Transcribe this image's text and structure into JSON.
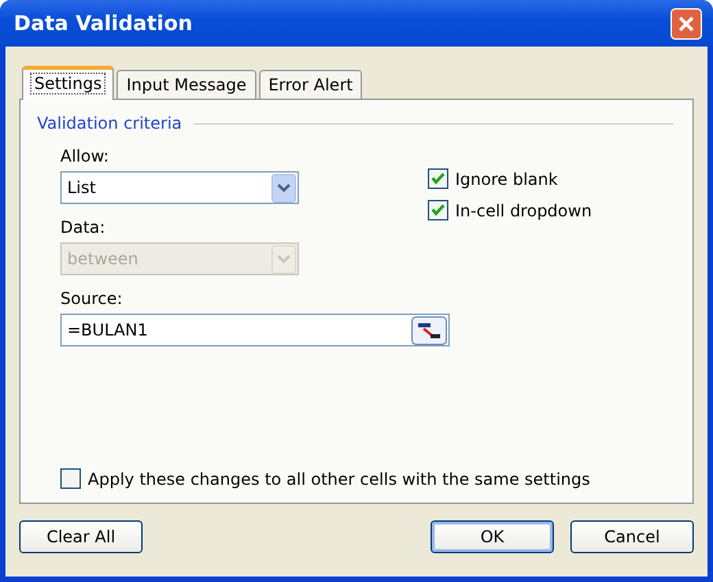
{
  "window": {
    "title": "Data Validation"
  },
  "tabs": [
    {
      "label": "Settings",
      "selected": true
    },
    {
      "label": "Input Message",
      "selected": false
    },
    {
      "label": "Error Alert",
      "selected": false
    }
  ],
  "group": {
    "title": "Validation criteria"
  },
  "allow": {
    "label": "Allow:",
    "value": "List",
    "disabled": false
  },
  "data": {
    "label": "Data:",
    "value": "between",
    "disabled": true
  },
  "options": [
    {
      "label": "Ignore blank",
      "checked": true
    },
    {
      "label": "In-cell dropdown",
      "checked": true
    }
  ],
  "source": {
    "label": "Source:",
    "value": "=BULAN1"
  },
  "apply": {
    "label": "Apply these changes to all other cells with the same settings",
    "checked": false
  },
  "buttons": [
    {
      "label": "Clear All",
      "kind": "left"
    },
    {
      "label": "OK",
      "kind": "default"
    },
    {
      "label": "Cancel",
      "kind": "normal"
    }
  ]
}
